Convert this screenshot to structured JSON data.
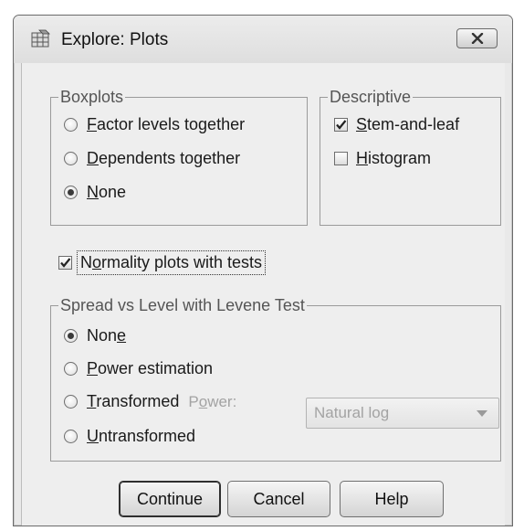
{
  "window": {
    "title": "Explore: Plots",
    "close_icon": "close-icon"
  },
  "boxplots": {
    "legend": "Boxplots",
    "options": [
      {
        "label": "Factor levels together",
        "mnemonic": "F",
        "rest": "actor levels together",
        "checked": false
      },
      {
        "label": "Dependents together",
        "mnemonic": "D",
        "rest": "ependents together",
        "checked": false
      },
      {
        "label": "None",
        "mnemonic": "N",
        "rest": "one",
        "checked": true
      }
    ]
  },
  "descriptive": {
    "legend": "Descriptive",
    "stem_and_leaf": {
      "mnemonic": "S",
      "rest": "tem-and-leaf",
      "checked": true
    },
    "histogram": {
      "mnemonic": "H",
      "rest": "istogram",
      "checked": false
    }
  },
  "normality": {
    "pre": "N",
    "mnemonic": "o",
    "rest": "rmality plots with tests",
    "checked": true
  },
  "spread": {
    "legend": "Spread vs Level with Levene Test",
    "none": {
      "pre": "Non",
      "mnemonic": "e",
      "checked": true
    },
    "power_estimation": {
      "mnemonic": "P",
      "rest": "ower estimation",
      "checked": false
    },
    "transformed": {
      "mnemonic": "T",
      "rest": "ransformed",
      "checked": false
    },
    "power_label": {
      "pre": "P",
      "mnemonic": "o",
      "rest": "wer:"
    },
    "power_value": "Natural log",
    "untransformed": {
      "mnemonic": "U",
      "rest": "ntransformed",
      "checked": false
    }
  },
  "buttons": {
    "continue": "Continue",
    "cancel": "Cancel",
    "help": "Help"
  }
}
